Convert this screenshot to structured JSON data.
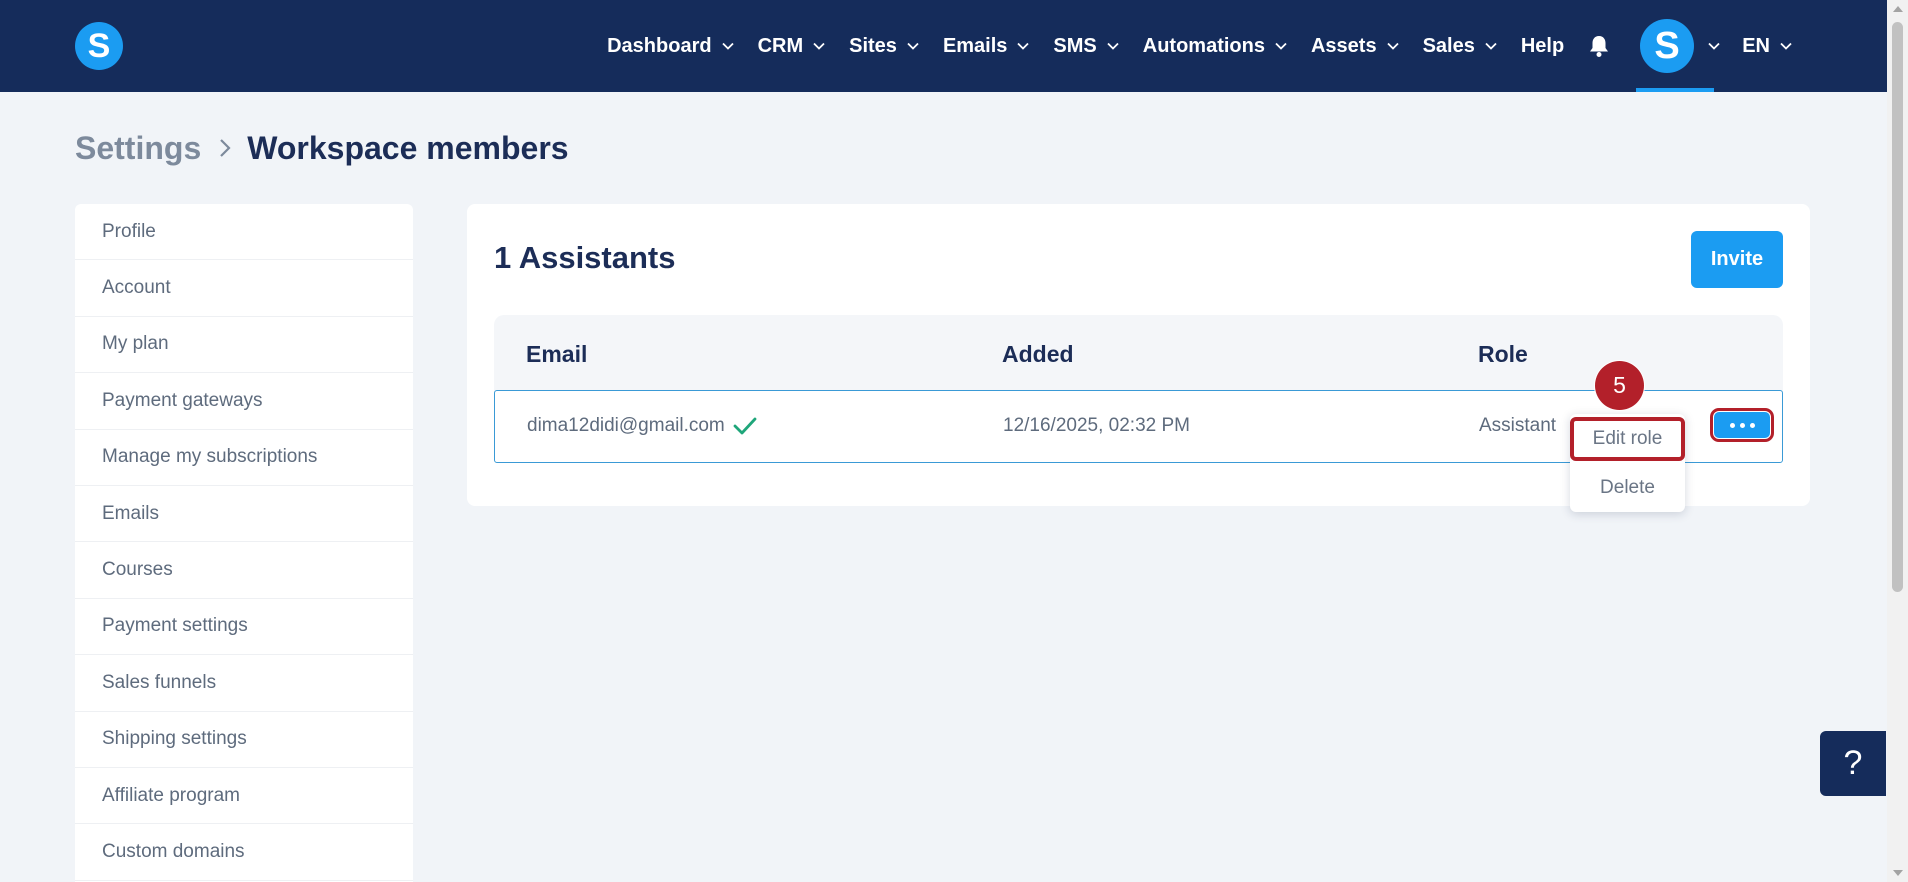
{
  "nav": {
    "items": [
      {
        "label": "Dashboard",
        "has_dropdown": true
      },
      {
        "label": "CRM",
        "has_dropdown": true
      },
      {
        "label": "Sites",
        "has_dropdown": true
      },
      {
        "label": "Emails",
        "has_dropdown": true
      },
      {
        "label": "SMS",
        "has_dropdown": true
      },
      {
        "label": "Automations",
        "has_dropdown": true
      },
      {
        "label": "Assets",
        "has_dropdown": true
      },
      {
        "label": "Sales",
        "has_dropdown": true
      },
      {
        "label": "Help",
        "has_dropdown": false
      }
    ],
    "language": "EN",
    "logo_letter": "S",
    "avatar_letter": "S"
  },
  "breadcrumb": {
    "parent": "Settings",
    "current": "Workspace members"
  },
  "sidebar": {
    "items": [
      {
        "label": "Profile"
      },
      {
        "label": "Account"
      },
      {
        "label": "My plan"
      },
      {
        "label": "Payment gateways"
      },
      {
        "label": "Manage my subscriptions"
      },
      {
        "label": "Emails"
      },
      {
        "label": "Courses"
      },
      {
        "label": "Payment settings"
      },
      {
        "label": "Sales funnels"
      },
      {
        "label": "Shipping settings"
      },
      {
        "label": "Affiliate program"
      },
      {
        "label": "Custom domains"
      }
    ]
  },
  "main": {
    "title": "1 Assistants",
    "invite_label": "Invite",
    "table": {
      "columns": [
        "Email",
        "Added",
        "Role"
      ],
      "rows": [
        {
          "email": "dima12didi@gmail.com",
          "added": "12/16/2025, 02:32 PM",
          "role": "Assistant",
          "verified": true
        }
      ]
    },
    "row_menu": {
      "items": [
        "Edit role",
        "Delete"
      ]
    }
  },
  "annotation": {
    "step": "5"
  },
  "help_button": "?",
  "colors": {
    "nav_bg": "#152c5b",
    "accent": "#1b9cf2",
    "highlight": "#b3202a",
    "page_bg": "#f1f4f8",
    "check": "#1fa67a"
  }
}
